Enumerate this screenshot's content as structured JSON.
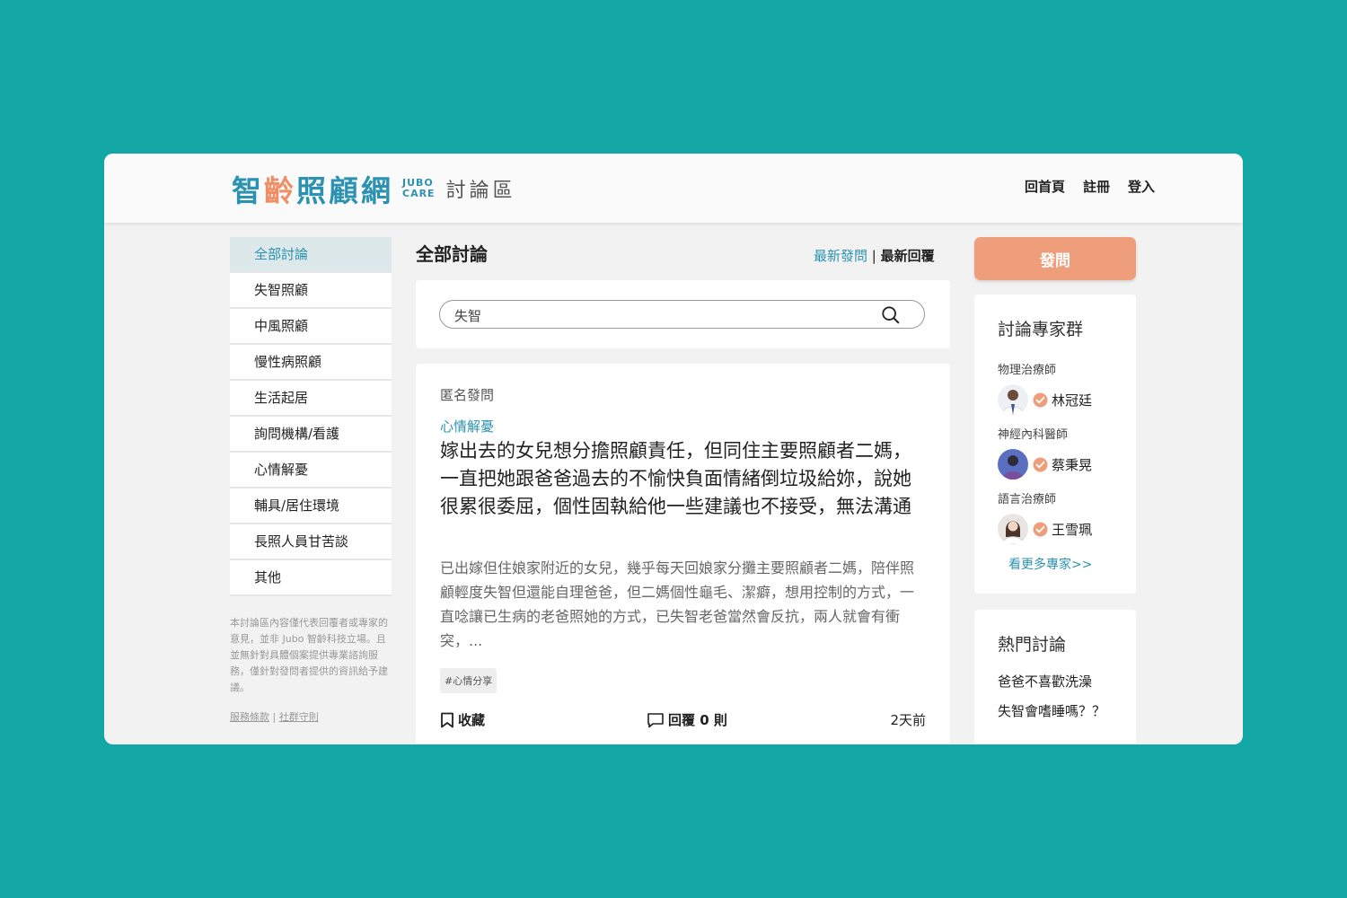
{
  "brand": {
    "logo_text": "智齡照顧網",
    "logo_en_top": "JUBO",
    "logo_en_bottom": "CARE",
    "section_name": "討論區",
    "accent_color": "#2b93b1",
    "highlight_color": "#ef9e7b"
  },
  "topnav": {
    "home": "回首頁",
    "register": "註冊",
    "login": "登入"
  },
  "sidebar": {
    "items": [
      {
        "label": "全部討論",
        "active": true
      },
      {
        "label": "失智照顧"
      },
      {
        "label": "中風照顧"
      },
      {
        "label": "慢性病照顧"
      },
      {
        "label": "生活起居"
      },
      {
        "label": "詢問機構/看護"
      },
      {
        "label": "心情解憂"
      },
      {
        "label": "輔具/居住環境"
      },
      {
        "label": "長照人員甘苦談"
      },
      {
        "label": "其他"
      }
    ],
    "disclaimer": "本討論區內容僅代表回覆者或專家的意見，並非 Jubo 智齡科技立場。且並無針對具體個案提供專業諮詢服務，僅針對發問者提供的資訊給予建議。",
    "legal_terms": "服務條款",
    "legal_separator": "|",
    "legal_rules": "社群守則"
  },
  "main": {
    "title": "全部討論",
    "sort_latest_posts": "最新發問",
    "sort_separator": "|",
    "sort_latest_replies": "最新回覆",
    "search": {
      "value": "失智",
      "placeholder": ""
    },
    "post": {
      "author": "匿名發問",
      "category": "心情解憂",
      "title": "嫁出去的女兒想分擔照顧責任，但同住主要照顧者二媽，一直把她跟爸爸過去的不愉快負面情緒倒垃圾給妳，說她很累很委屈，個性固執給他一些建議也不接受，無法溝通",
      "excerpt": "已出嫁但住娘家附近的女兒，幾乎每天回娘家分攤主要照顧者二媽，陪伴照顧輕度失智但還能自理爸爸，但二媽個性龜毛、潔癖，想用控制的方式，一直唸讓已生病的老爸照她的方式，已失智老爸當然會反抗，兩人就會有衝突，...",
      "tag": "#心情分享",
      "save_label": "收藏",
      "reply_label": "回覆 0 則",
      "time": "2天前"
    }
  },
  "right": {
    "ask_button": "發問",
    "experts_title": "討論專家群",
    "experts": [
      {
        "role": "物理治療師",
        "name": "林冠廷"
      },
      {
        "role": "神經內科醫師",
        "name": "蔡秉晃"
      },
      {
        "role": "語言治療師",
        "name": "王雪珮"
      }
    ],
    "more_experts": "看更多專家>>",
    "hot_title": "熱門討論",
    "hot_items": [
      "爸爸不喜歡洗澡",
      "失智會嗜睡嗎？？"
    ]
  }
}
